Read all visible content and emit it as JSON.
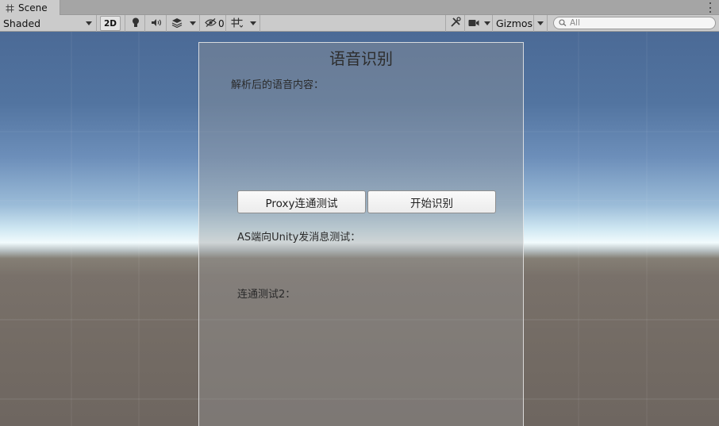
{
  "tab": {
    "label": "Scene",
    "icon": "hash-grid-icon"
  },
  "toolbar": {
    "shading_mode": "Shaded",
    "mode_2d": "2D",
    "hidden_count": "0",
    "gizmos_label": "Gizmos",
    "search_placeholder": "All"
  },
  "ui": {
    "title": "语音识别",
    "parsed_label": "解析后的语音内容：",
    "proxy_button": "Proxy连通测试",
    "start_button": "开始识别",
    "as_label": "AS端向Unity发消息测试：",
    "test2_label": "连通测试2："
  }
}
